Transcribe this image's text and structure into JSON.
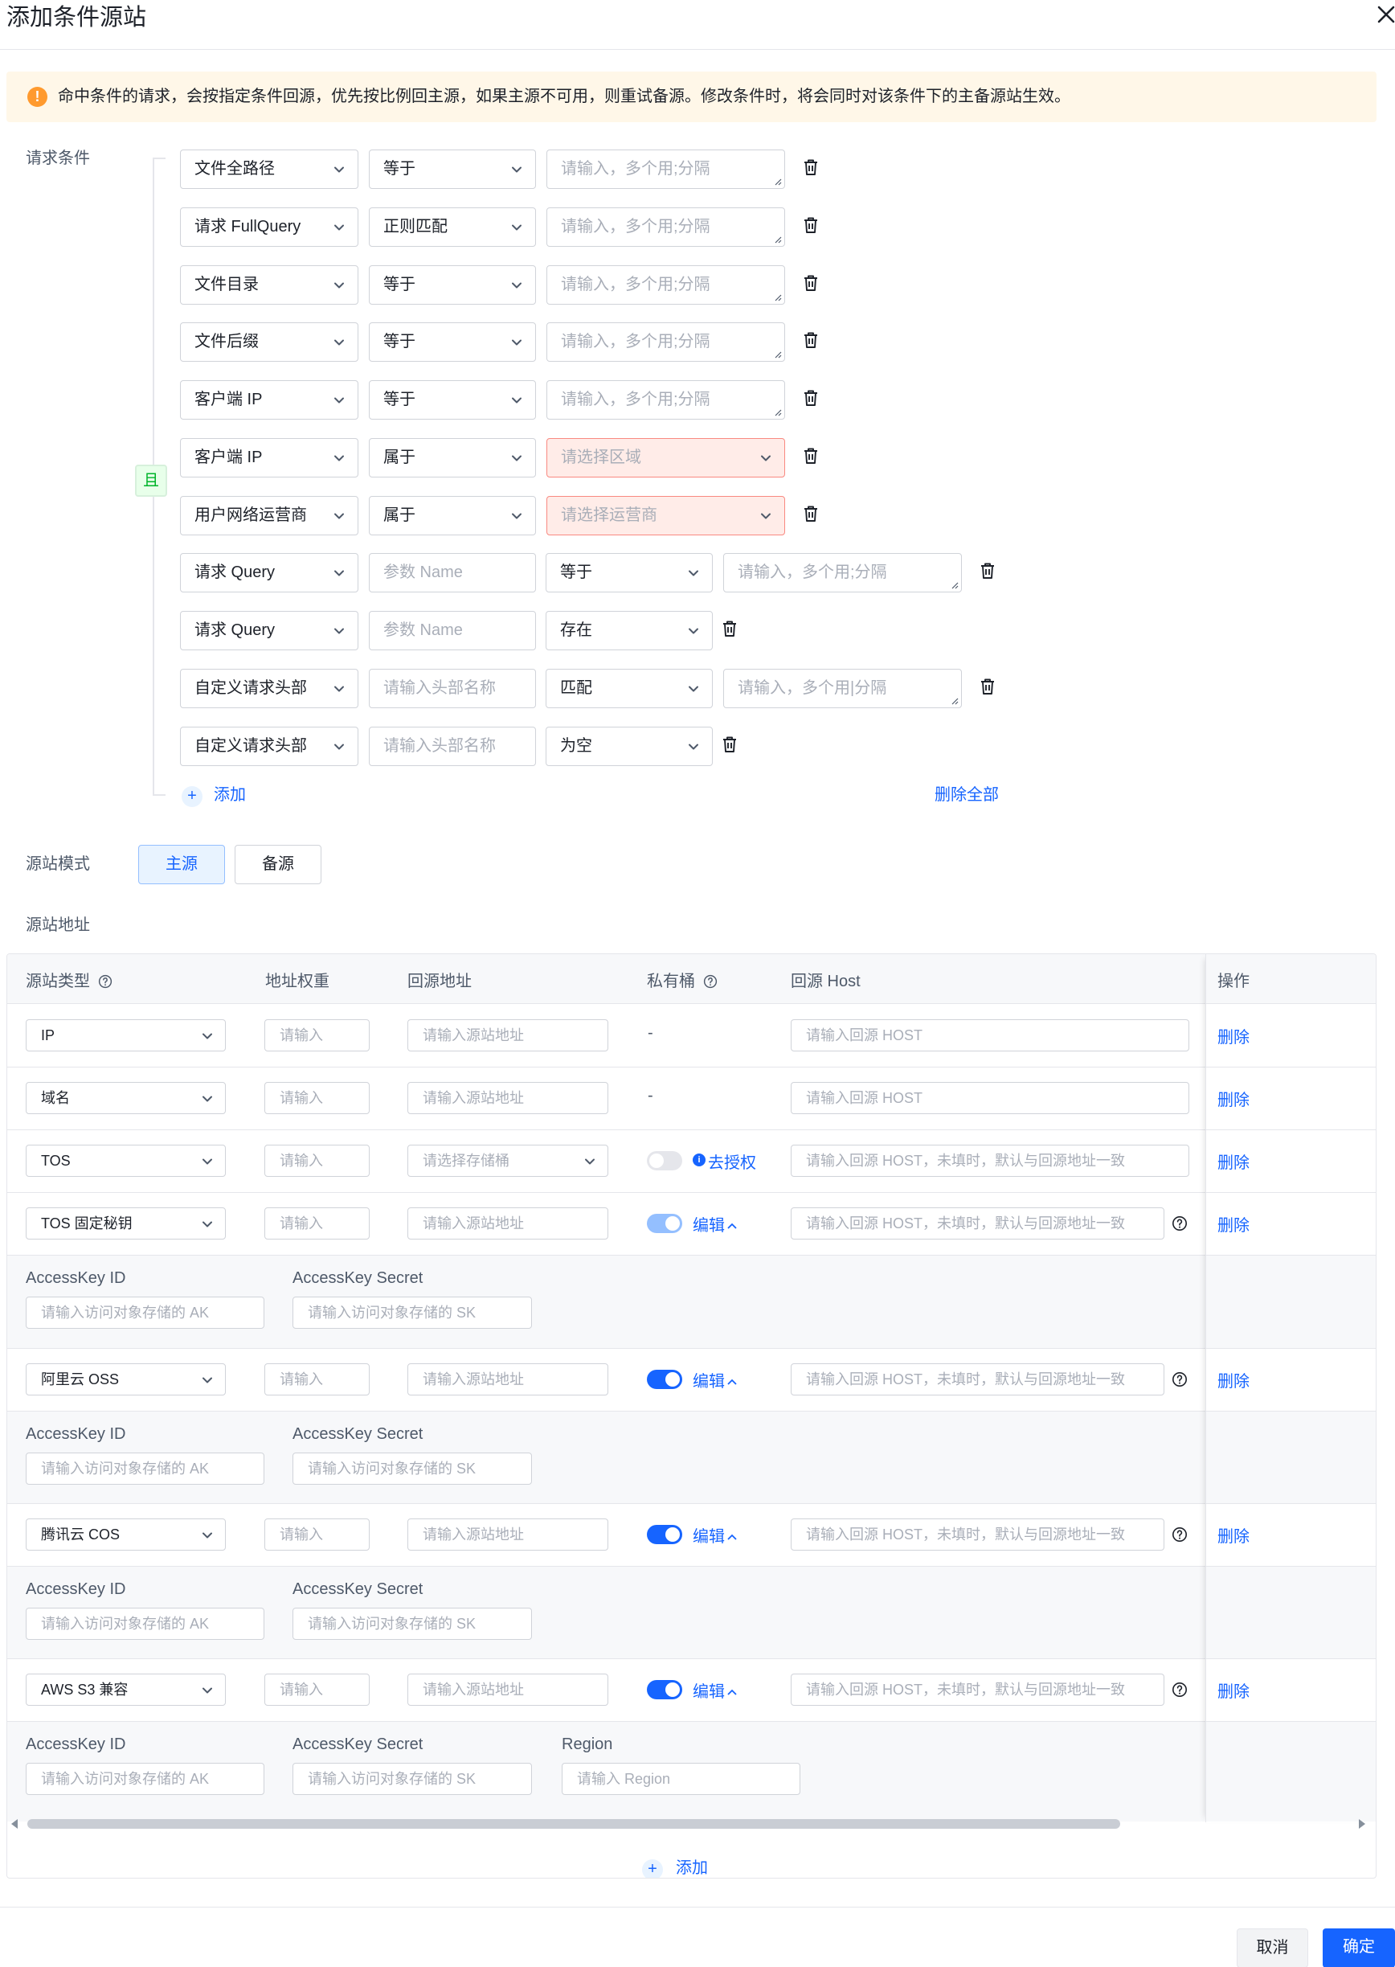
{
  "dialog": {
    "title": "添加条件源站"
  },
  "notice": {
    "text": "命中条件的请求，会按指定条件回源，优先按比例回主源，如果主源不可用，则重试备源。修改条件时，将会同时对该条件下的主备源站生效。"
  },
  "conditions": {
    "label": "请求条件",
    "logic": "且",
    "rows": [
      {
        "field": "文件全路径",
        "op": "等于",
        "value_placeholder": "请输入，多个用;分隔"
      },
      {
        "field": "请求 FullQuery",
        "op": "正则匹配",
        "value_placeholder": "请输入，多个用;分隔"
      },
      {
        "field": "文件目录",
        "op": "等于",
        "value_placeholder": "请输入，多个用;分隔"
      },
      {
        "field": "文件后缀",
        "op": "等于",
        "value_placeholder": "请输入，多个用;分隔"
      },
      {
        "field": "客户端 IP",
        "op": "等于",
        "value_placeholder": "请输入，多个用;分隔"
      },
      {
        "field": "客户端 IP",
        "op": "属于",
        "value_placeholder": "请选择区域"
      },
      {
        "field": "用户网络运营商",
        "op": "属于",
        "value_placeholder": "请选择运营商"
      },
      {
        "field": "请求 Query",
        "name_placeholder": "参数 Name",
        "op": "等于",
        "value_placeholder": "请输入，多个用;分隔"
      },
      {
        "field": "请求 Query",
        "name_placeholder": "参数 Name",
        "op": "存在"
      },
      {
        "field": "自定义请求头部",
        "name_placeholder": "请输入头部名称",
        "op": "匹配",
        "value_placeholder": "请输入，多个用|分隔"
      },
      {
        "field": "自定义请求头部",
        "name_placeholder": "请输入头部名称",
        "op": "为空"
      }
    ],
    "add_label": "添加",
    "delete_all_label": "删除全部"
  },
  "mode": {
    "label": "源站模式",
    "options": [
      "主源",
      "备源"
    ],
    "selected": "主源"
  },
  "origins": {
    "label": "源站地址",
    "columns": [
      "源站类型",
      "地址权重",
      "回源地址",
      "私有桶",
      "回源 Host",
      "操作"
    ],
    "weight_placeholder": "请输入",
    "delete_label": "删除",
    "ak_label": "AccessKey ID",
    "sk_label": "AccessKey Secret",
    "region_label": "Region",
    "ak_placeholder": "请输入访问对象存储的 AK",
    "sk_placeholder": "请输入访问对象存储的 SK",
    "region_placeholder": "请输入 Region",
    "rows": [
      {
        "type": "IP",
        "address_placeholder": "请输入源站地址",
        "private": "-",
        "host_placeholder": "请输入回源 HOST"
      },
      {
        "type": "域名",
        "address_placeholder": "请输入源站地址",
        "private": "-",
        "host_placeholder": "请输入回源 HOST"
      },
      {
        "type": "TOS",
        "address_placeholder": "请选择存储桶",
        "private_action": "去授权",
        "host_placeholder": "请输入回源 HOST，未填时，默认与回源地址一致"
      },
      {
        "type": "TOS 固定秘钥",
        "address_placeholder": "请输入源站地址",
        "private_action": "编辑",
        "host_placeholder": "请输入回源 HOST，未填时，默认与回源地址一致"
      },
      {
        "type": "阿里云 OSS",
        "address_placeholder": "请输入源站地址",
        "private_action": "编辑",
        "host_placeholder": "请输入回源 HOST，未填时，默认与回源地址一致"
      },
      {
        "type": "腾讯云 COS",
        "address_placeholder": "请输入源站地址",
        "private_action": "编辑",
        "host_placeholder": "请输入回源 HOST，未填时，默认与回源地址一致"
      },
      {
        "type": "AWS S3 兼容",
        "address_placeholder": "请输入源站地址",
        "private_action": "编辑",
        "host_placeholder": "请输入回源 HOST，未填时，默认与回源地址一致"
      }
    ],
    "add_label": "添加"
  },
  "footer": {
    "cancel": "取消",
    "confirm": "确定"
  },
  "colors": {
    "primary": "#1664ff",
    "warning": "#ff9a2e",
    "error_bg": "#ffece8",
    "success": "#00b42a"
  }
}
